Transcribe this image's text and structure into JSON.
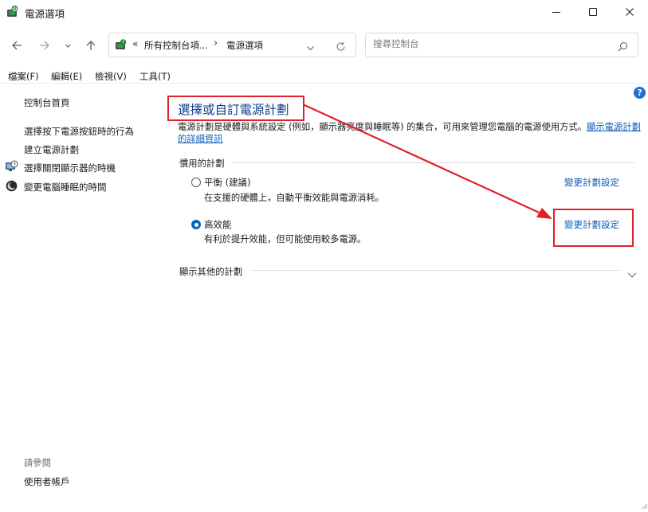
{
  "window": {
    "title": "電源選項",
    "icon": "power-options-icon",
    "controls": [
      "minimize-icon",
      "maximize-icon",
      "close-icon"
    ]
  },
  "address_bar": {
    "overflow": "«",
    "crumbs": [
      "所有控制台項...",
      "電源選項"
    ],
    "separator": "›"
  },
  "search": {
    "placeholder": "搜尋控制台"
  },
  "menu": [
    "檔案(F)",
    "編輯(E)",
    "檢視(V)",
    "工具(T)"
  ],
  "left_pane": {
    "home": "控制台首頁",
    "links": [
      {
        "label": "選擇按下電源按鈕時的行為",
        "icon": ""
      },
      {
        "label": "建立電源計劃",
        "icon": ""
      },
      {
        "label": "選擇關閉顯示器的時機",
        "icon": "monitor-clock-icon"
      },
      {
        "label": "變更電腦睡眠的時間",
        "icon": "moon-icon"
      }
    ],
    "see_also": "請參閱",
    "see_also_links": [
      "使用者帳戶"
    ]
  },
  "main": {
    "title": "選擇或自訂電源計劃",
    "description": "電源計劃是硬體與系統設定 (例如，顯示器亮度與睡眠等) 的集合，可用來管理您電腦的電源使用方式。",
    "description_link": "顯示電源計劃的詳細資訊",
    "preferred_plans_label": "慣用的計劃",
    "plans": [
      {
        "name": "平衡 (建議)",
        "description": "在支援的硬體上，自動平衡效能與電源消耗。",
        "selected": false,
        "change_link": "變更計劃設定"
      },
      {
        "name": "高效能",
        "description": "有利於提升效能，但可能使用較多電源。",
        "selected": true,
        "change_link": "變更計劃設定"
      }
    ],
    "other_plans_label": "顯示其他的計劃"
  },
  "annotation": {
    "color": "#e0202a"
  },
  "colors": {
    "link": "#0a5db8",
    "title": "#0c3e8c",
    "accent": "#0067c0"
  }
}
